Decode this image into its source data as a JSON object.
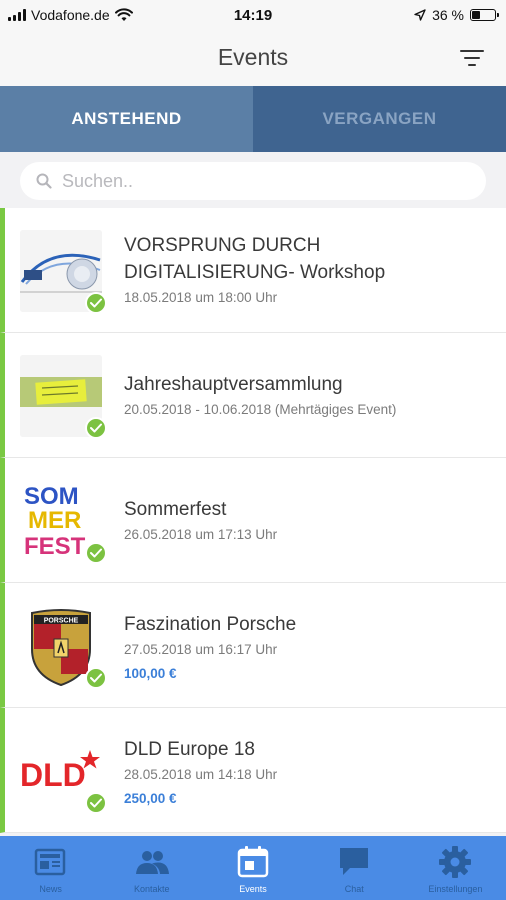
{
  "statusbar": {
    "carrier": "Vodafone.de",
    "time": "14:19",
    "battery": "36 %",
    "battery_level": 0.36
  },
  "navbar": {
    "title": "Events",
    "filter_icon": "filter-icon"
  },
  "tabs": [
    {
      "label": "ANSTEHEND",
      "active": true
    },
    {
      "label": "VERGANGEN",
      "active": false
    }
  ],
  "search": {
    "placeholder": "Suchen..",
    "value": ""
  },
  "events": [
    {
      "title_lines": [
        "VORSPRUNG DURCH",
        "DIGITALISIERUNG- Workshop"
      ],
      "date": "18.05.2018 um 18:00 Uhr",
      "price": ""
    },
    {
      "title_lines": [
        "Jahreshauptversammlung"
      ],
      "date": "20.05.2018 - 10.06.2018 (Mehrtägiges Event)",
      "price": ""
    },
    {
      "title_lines": [
        "Sommerfest"
      ],
      "date": "26.05.2018 um 17:13 Uhr",
      "price": "",
      "thumb_letters": [
        "SOM",
        "MER",
        "FEST"
      ]
    },
    {
      "title_lines": [
        "Faszination Porsche"
      ],
      "date": "27.05.2018 um 16:17 Uhr",
      "price": "100,00 €",
      "thumb_text": "PORSCHE"
    },
    {
      "title_lines": [
        "DLD Europe 18"
      ],
      "date": "28.05.2018 um 14:18 Uhr",
      "price": "250,00 €",
      "thumb_text": "DLD"
    }
  ],
  "tabbar": [
    {
      "label": "News",
      "icon": "newspaper-icon",
      "active": false
    },
    {
      "label": "Kontakte",
      "icon": "people-icon",
      "active": false
    },
    {
      "label": "Events",
      "icon": "calendar-icon",
      "active": true
    },
    {
      "label": "Chat",
      "icon": "chat-bubble-icon",
      "active": false
    },
    {
      "label": "Einstellungen",
      "icon": "gear-icon",
      "active": false
    }
  ],
  "colors": {
    "tab_active": "#5b7fa6",
    "tab_inactive": "#3f6490",
    "accent_green": "#7ac943",
    "price_blue": "#3b7fd8",
    "tabbar_bg": "#4a8be5"
  }
}
